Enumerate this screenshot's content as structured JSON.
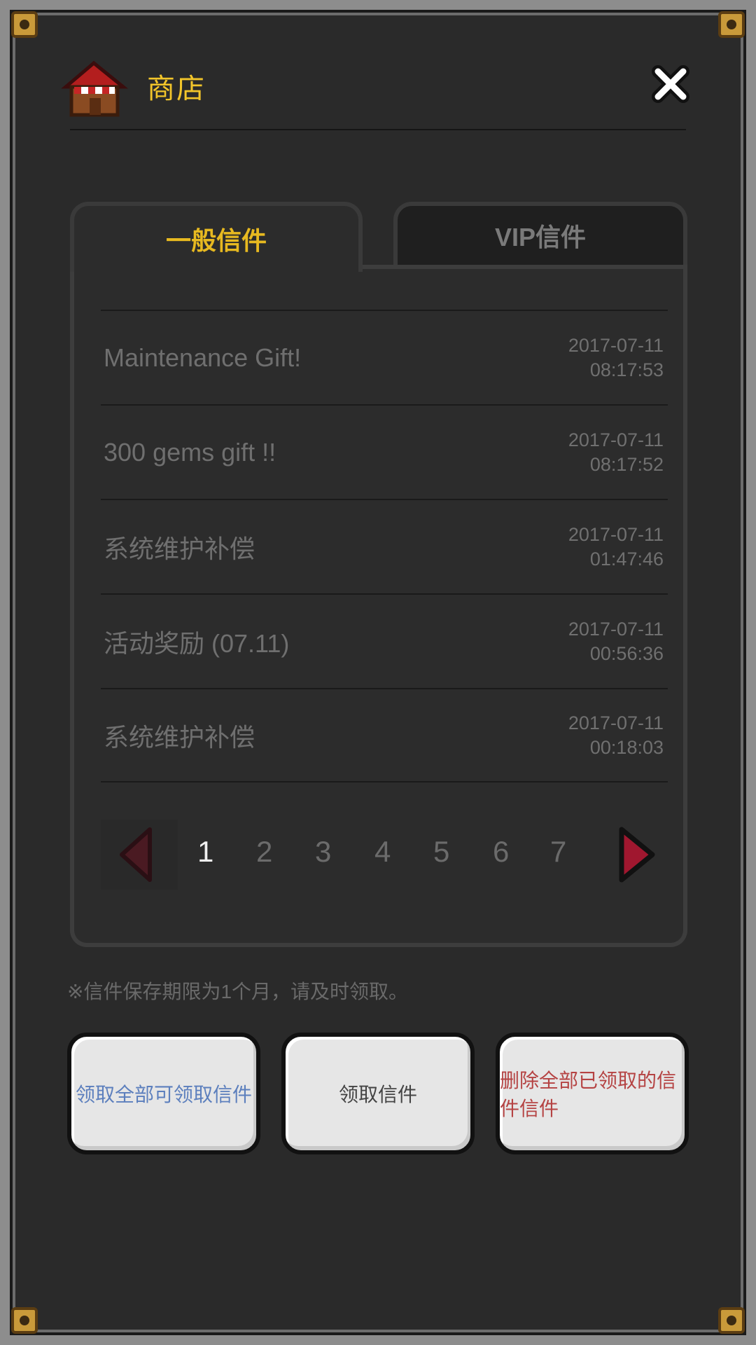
{
  "header": {
    "title": "商店",
    "shop_icon": "shop-icon",
    "close_icon": "close-icon"
  },
  "tabs": [
    {
      "label": "一般信件"
    },
    {
      "label": "VIP信件"
    }
  ],
  "mail_list": [
    {
      "title": "Maintenance Gift!",
      "date": "2017-07-11",
      "time": "08:17:53"
    },
    {
      "title": "300 gems gift !!",
      "date": "2017-07-11",
      "time": "08:17:52"
    },
    {
      "title": "系统维护补偿",
      "date": "2017-07-11",
      "time": "01:47:46"
    },
    {
      "title": "活动奖励 (07.11)",
      "date": "2017-07-11",
      "time": "00:56:36"
    },
    {
      "title": "系统维护补偿",
      "date": "2017-07-11",
      "time": "00:18:03"
    }
  ],
  "pagination": {
    "pages": [
      "1",
      "2",
      "3",
      "4",
      "5",
      "6",
      "7"
    ],
    "current": "1",
    "prev_icon": "arrow-left-icon",
    "next_icon": "arrow-right-icon"
  },
  "note": "※信件保存期限为1个月，请及时领取。",
  "buttons": {
    "receive_all": "领取全部可领取信件",
    "receive": "领取信件",
    "delete_all": "删除全部已领取的信件信件"
  },
  "colors": {
    "title_gold": "#f2c52a",
    "tab_active_gold": "#e7b920",
    "button_blue_text": "#5c7fbd",
    "button_red_text": "#b54343",
    "arrow_red": "#a0172f"
  }
}
